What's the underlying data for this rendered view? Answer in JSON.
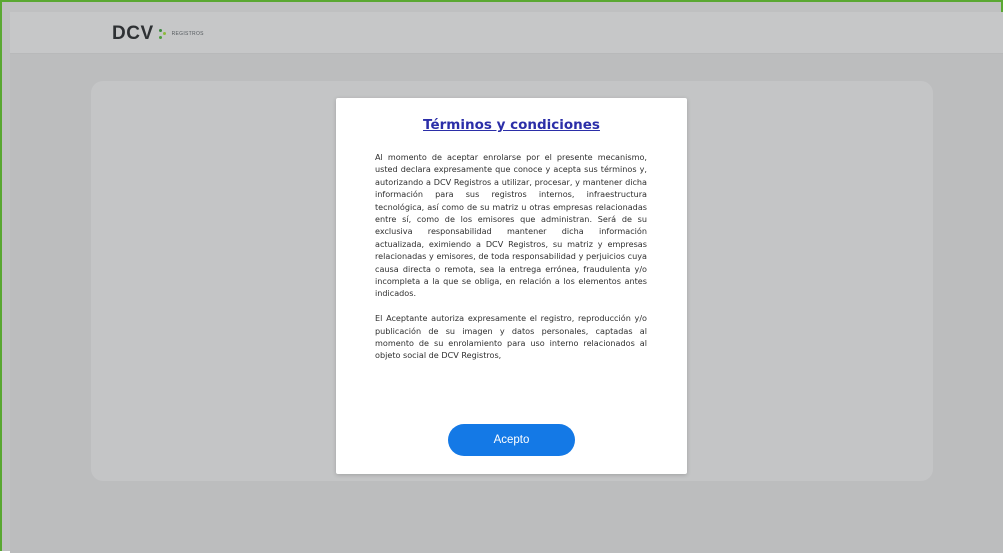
{
  "header": {
    "logo_text": "DCV",
    "logo_sub": "REGISTROS"
  },
  "modal": {
    "title": "Términos y condiciones",
    "paragraphs": [
      "Al momento de aceptar enrolarse por el presente mecanismo, usted declara expresamente que conoce y acepta sus términos y, autorizando a DCV Registros a utilizar, procesar, y mantener dicha información para sus registros internos, infraestructura tecnológica, así como de su matriz u otras empresas relacionadas entre sí, como de los emisores que administran. Será de su exclusiva responsabilidad mantener dicha información actualizada, eximiendo a DCV Registros, su matriz y empresas relacionadas y emisores, de toda responsabilidad y perjuicios cuya causa directa o remota, sea la entrega errónea, fraudulenta y/o incompleta a la que se obliga, en relación a los elementos antes indicados.",
      "El Aceptante autoriza expresamente el registro, reproducción y/o publicación de su imagen y datos personales, captadas al momento de su enrolamiento para uso interno relacionados al objeto social de DCV Registros,"
    ],
    "accept_label": "Acepto"
  },
  "colors": {
    "title_link": "#2b2ea8",
    "accept_button": "#1479e6",
    "frame_border": "#5aa832",
    "overlay_bg": "#bcbdbe"
  }
}
